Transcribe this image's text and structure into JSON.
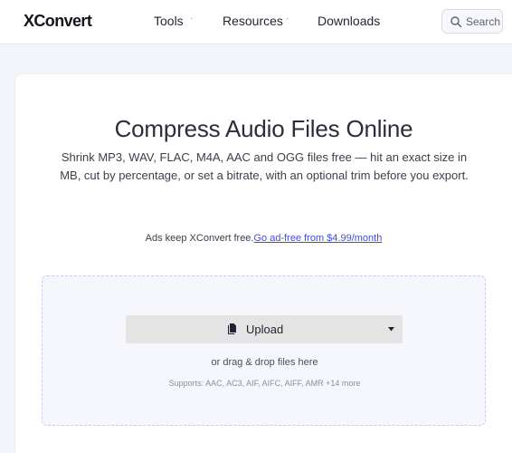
{
  "header": {
    "logo": "XConvert",
    "nav": [
      {
        "label": "Tools",
        "has_dropdown": true
      },
      {
        "label": "Resources",
        "has_dropdown": true
      },
      {
        "label": "Downloads",
        "has_dropdown": false
      }
    ],
    "nav_dot": "·",
    "search_label": "Search"
  },
  "main": {
    "title": "Compress Audio Files Online",
    "subtitle": "Shrink MP3, WAV, FLAC, M4A, AAC and OGG files free — hit an exact size in MB, cut by percentage, or set a bitrate, with an optional trim before you export.",
    "ads_text": "Ads keep XConvert free.",
    "ads_link": "Go ad-free from $4.99/month"
  },
  "dropzone": {
    "upload_label": "Upload",
    "drag_text": "or drag & drop files here",
    "supports_text": "Supports: AAC, AC3, AIF, AIFC, AIFF, AMR +14 more"
  },
  "colors": {
    "accent_link": "#3f4de0",
    "dropzone_border": "#c9cdea",
    "background": "#f3f5fa"
  }
}
